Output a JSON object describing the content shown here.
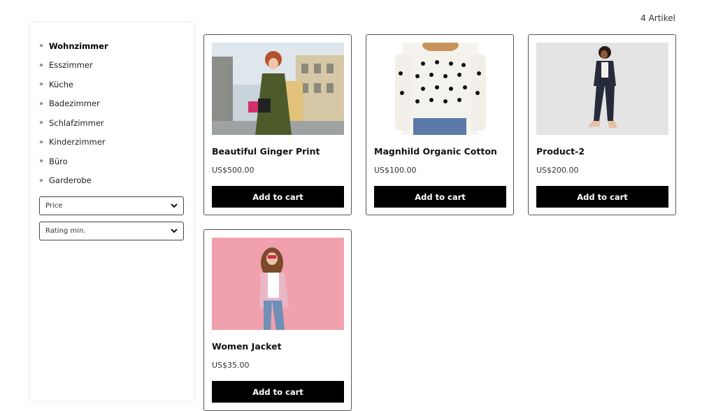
{
  "results": {
    "count_label": "4 Artikel"
  },
  "sidebar": {
    "chevron": "»",
    "categories": [
      {
        "label": "Wohnzimmer",
        "active": true
      },
      {
        "label": "Esszimmer"
      },
      {
        "label": "Küche"
      },
      {
        "label": "Badezimmer"
      },
      {
        "label": "Schlafzimmer"
      },
      {
        "label": "Kinderzimmer"
      },
      {
        "label": "Büro"
      },
      {
        "label": "Garderobe"
      }
    ],
    "filters": {
      "price": "Price",
      "rating": "Rating min."
    }
  },
  "products": [
    {
      "name": "Beautiful Ginger Print",
      "price": "US$500.00",
      "button": "Add to cart"
    },
    {
      "name": "Magnhild Organic Cotton",
      "price": "US$100.00",
      "button": "Add to cart"
    },
    {
      "name": "Product-2",
      "price": "US$200.00",
      "button": "Add to cart"
    },
    {
      "name": "Women Jacket",
      "price": "US$35.00",
      "button": "Add to cart"
    }
  ]
}
